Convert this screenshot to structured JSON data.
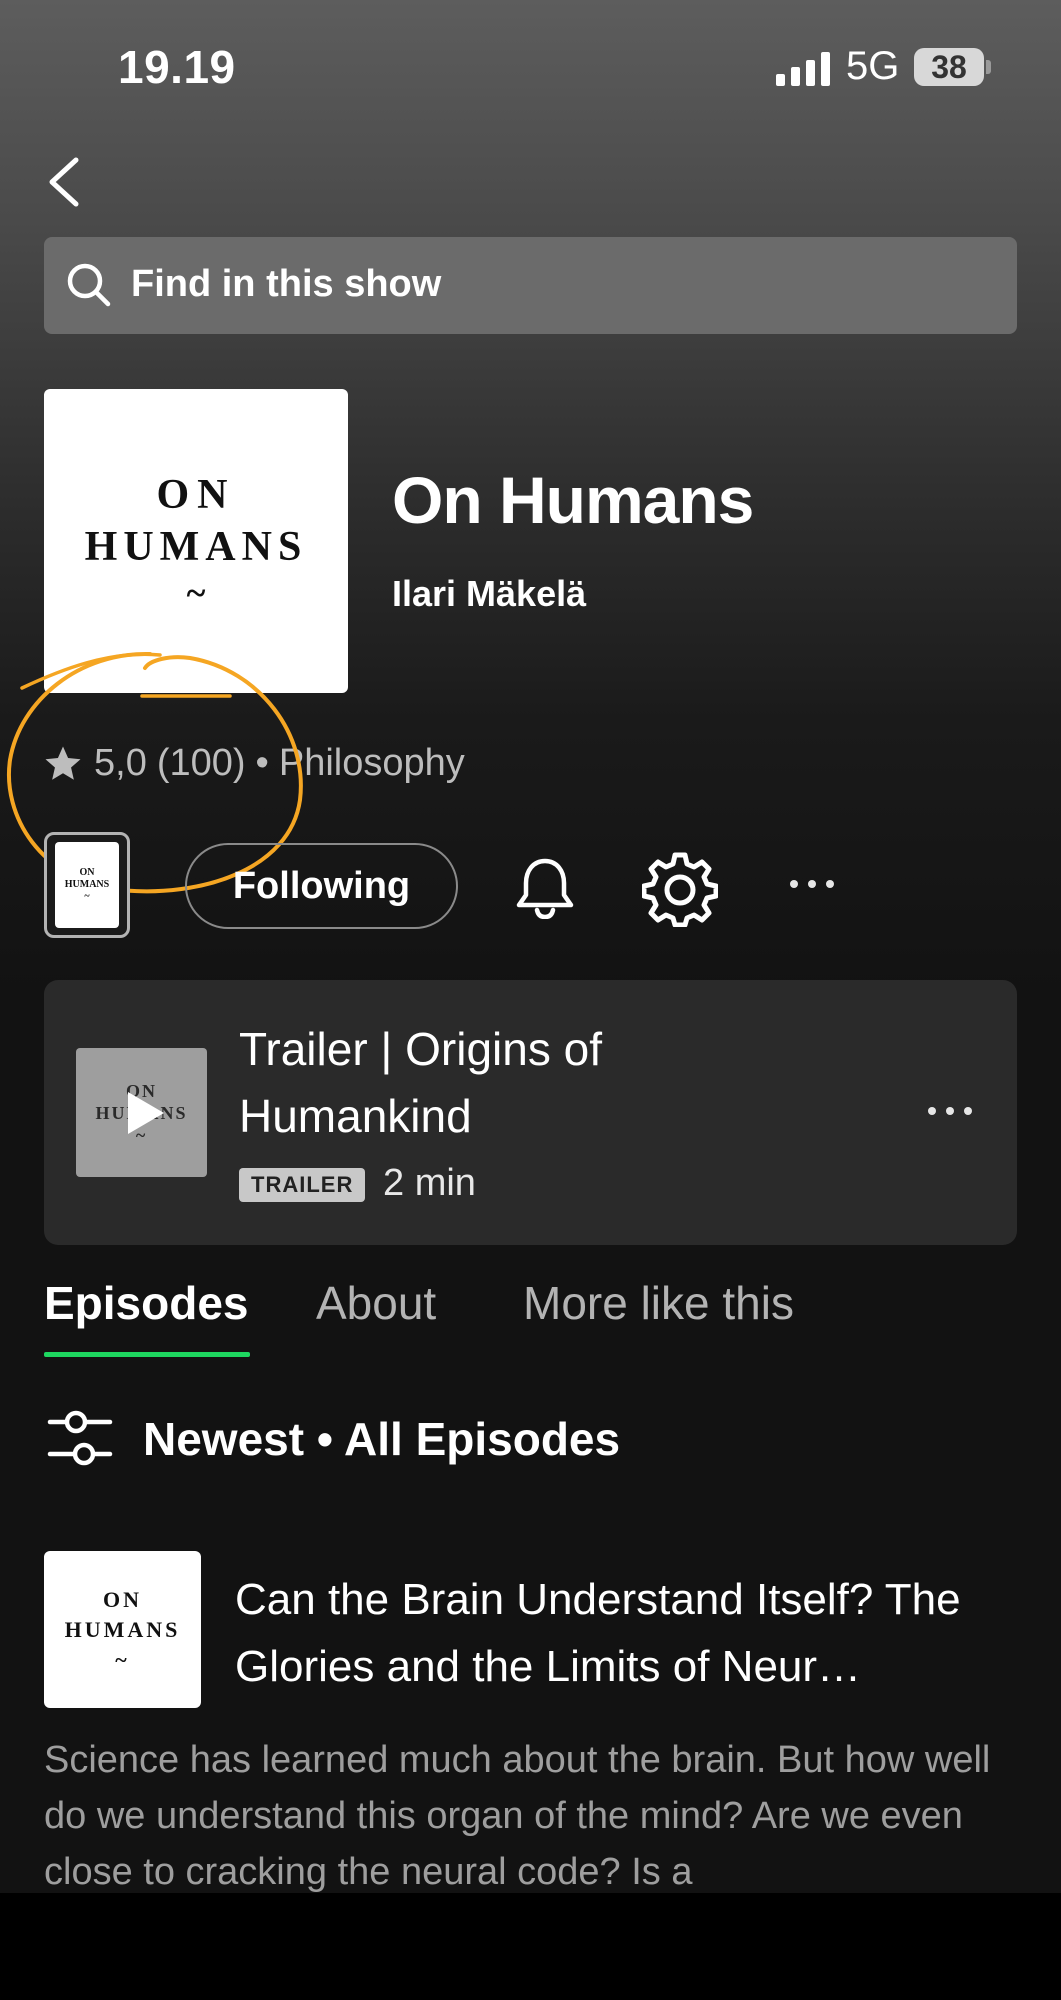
{
  "status_bar": {
    "time": "19.19",
    "network": "5G",
    "battery": "38"
  },
  "search": {
    "placeholder": "Find in this show"
  },
  "show": {
    "cover_line1": "ON",
    "cover_line2": "HUMANS",
    "cover_line3": "~",
    "title": "On Humans",
    "author": "Ilari Mäkelä",
    "rating": "5,0",
    "rating_count": "(100)",
    "separator": "•",
    "category": "Philosophy"
  },
  "actions": {
    "following_label": "Following"
  },
  "trailer": {
    "title": "Trailer | Origins of Humankind",
    "badge": "TRAILER",
    "duration": "2 min",
    "thumb_line1": "ON",
    "thumb_line2": "HUMANS",
    "thumb_line3": "~"
  },
  "tabs": [
    {
      "label": "Episodes",
      "active": true
    },
    {
      "label": "About",
      "active": false
    },
    {
      "label": "More like this",
      "active": false
    }
  ],
  "filter": {
    "label": "Newest • All Episodes"
  },
  "episode": {
    "cover_line1": "ON",
    "cover_line2": "HUMANS",
    "cover_line3": "~",
    "title": "Can the Brain Understand Itself? The Glories and the Limits of Neur…",
    "description": "Science has learned much about the brain. But how well do we understand this organ of the mind? Are we even close to cracking the neural code? Is a"
  },
  "colors": {
    "accent": "#1ed760",
    "annotation": "#f5a623",
    "background": "#121212"
  },
  "icons": [
    "back-icon",
    "search-icon",
    "star-icon",
    "bell-icon",
    "gear-icon",
    "more-icon",
    "play-icon",
    "filter-icon"
  ]
}
